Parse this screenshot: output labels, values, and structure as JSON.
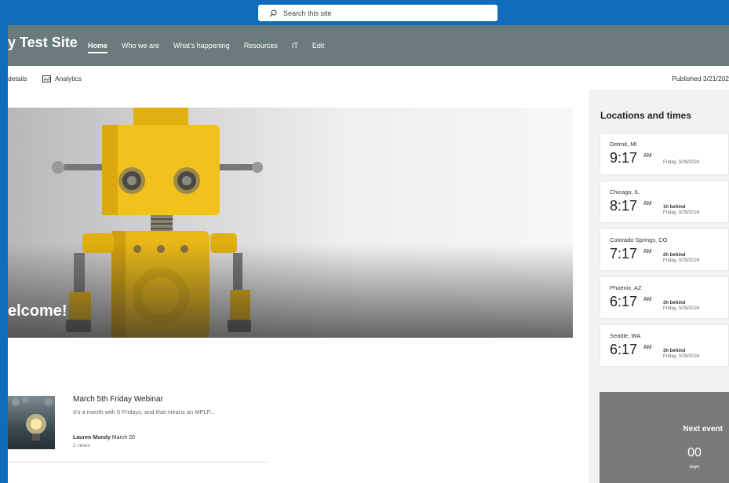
{
  "search": {
    "placeholder": "Search this site"
  },
  "site": {
    "title": "y Test Site",
    "nav": [
      {
        "label": "Home",
        "active": true
      },
      {
        "label": "Who we are"
      },
      {
        "label": "What's happening"
      },
      {
        "label": "Resources"
      },
      {
        "label": "IT"
      },
      {
        "label": "Edit"
      }
    ]
  },
  "commands": {
    "details": "details",
    "analytics": "Analytics",
    "published": "Published 3/21/202"
  },
  "hero": {
    "caption": "elcome!"
  },
  "news": {
    "title": "March 5th Friday Webinar",
    "excerpt": "It's a month with 5 Fridays, and that means an MPLP...",
    "author": "Lauren Mundy",
    "date": "March 20",
    "views": "2 views"
  },
  "locations": {
    "title": "Locations and times",
    "items": [
      {
        "city": "Detroit, MI",
        "time": "9:17",
        "ampm": "AM",
        "offset": "",
        "date": "Friday, 3/29/2024"
      },
      {
        "city": "Chicago, IL",
        "time": "8:17",
        "ampm": "AM",
        "offset": "1h behind",
        "date": "Friday, 3/29/2024"
      },
      {
        "city": "Colorado Springs, CO",
        "time": "7:17",
        "ampm": "AM",
        "offset": "2h behind",
        "date": "Friday, 3/29/2024"
      },
      {
        "city": "Phoenix, AZ",
        "time": "6:17",
        "ampm": "AM",
        "offset": "3h behind",
        "date": "Friday, 3/29/2024"
      },
      {
        "city": "Seattle, WA",
        "time": "6:17",
        "ampm": "AM",
        "offset": "3h behind",
        "date": "Friday, 3/29/2024"
      }
    ]
  },
  "event": {
    "title": "Next event",
    "count": "00",
    "unit": "days"
  },
  "icons": {
    "search": "search-icon",
    "analytics": "analytics-icon"
  },
  "colors": {
    "suite_bar": "#0f6cbd",
    "site_header": "#6b7a7d",
    "event_tile": "#7a7a7a"
  }
}
